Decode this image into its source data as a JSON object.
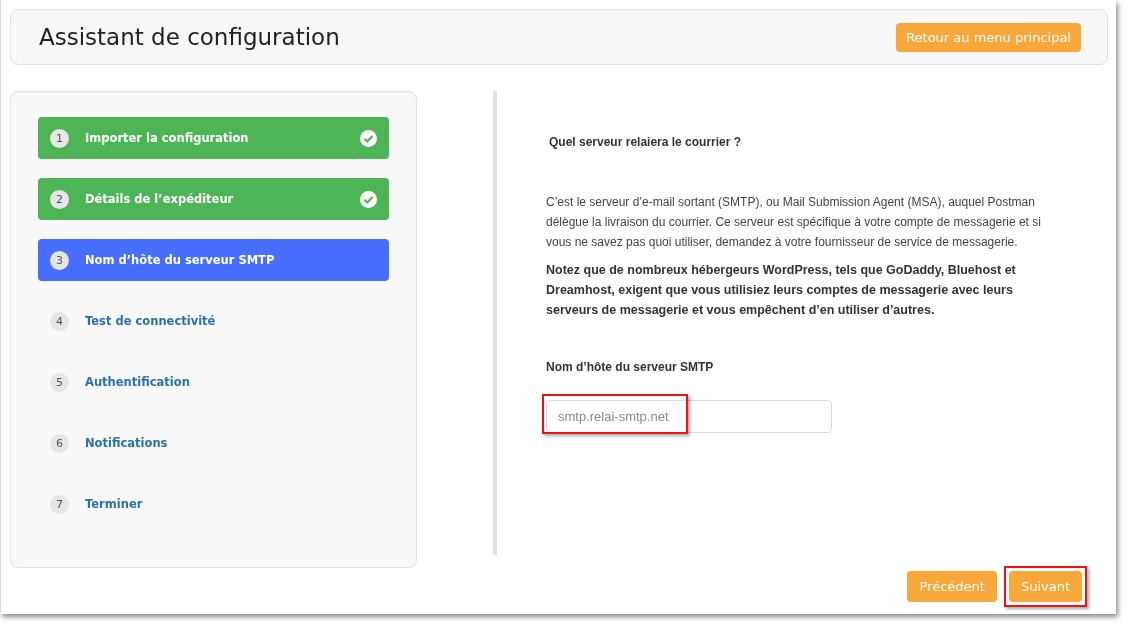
{
  "header": {
    "title": "Assistant de configuration",
    "back_button": "Retour au menu principal"
  },
  "steps": [
    {
      "number": "1",
      "label": "Importer la configuration",
      "completed": true,
      "selected": false
    },
    {
      "number": "2",
      "label": "Détails de l’expéditeur",
      "completed": true,
      "selected": false
    },
    {
      "number": "3",
      "label": "Nom d’hôte du serveur SMTP",
      "completed": false,
      "selected": true
    },
    {
      "number": "4",
      "label": "Test de connectivité",
      "completed": false,
      "selected": false
    },
    {
      "number": "5",
      "label": "Authentification",
      "completed": false,
      "selected": false
    },
    {
      "number": "6",
      "label": "Notifications",
      "completed": false,
      "selected": false
    },
    {
      "number": "7",
      "label": "Terminer",
      "completed": false,
      "selected": false
    }
  ],
  "content": {
    "question": "Quel serveur relaiera le courrier ?",
    "description": "C’est le serveur d’e-mail sortant (SMTP), ou Mail Submission Agent (MSA), auquel Postman délègue la livraison du courrier. Ce serveur est spécifique à votre compte de messagerie et si vous ne savez pas quoi utiliser, demandez à votre fournisseur de service de messagerie.",
    "note": "Notez que de nombreux hébergeurs WordPress, tels que GoDaddy, Bluehost et Dreamhost, exigent que vous utilisiez leurs comptes de messagerie avec leurs serveurs de messagerie et vous empêchent d’en utiliser d’autres.",
    "field_label": "Nom d’hôte du serveur SMTP",
    "field": {
      "placeholder": "smtp.relai-smtp.net",
      "highlighted": true
    }
  },
  "footer": {
    "buttons": [
      {
        "label": "Précédent",
        "highlighted": false
      },
      {
        "label": "Suivant",
        "highlighted": true
      }
    ]
  }
}
